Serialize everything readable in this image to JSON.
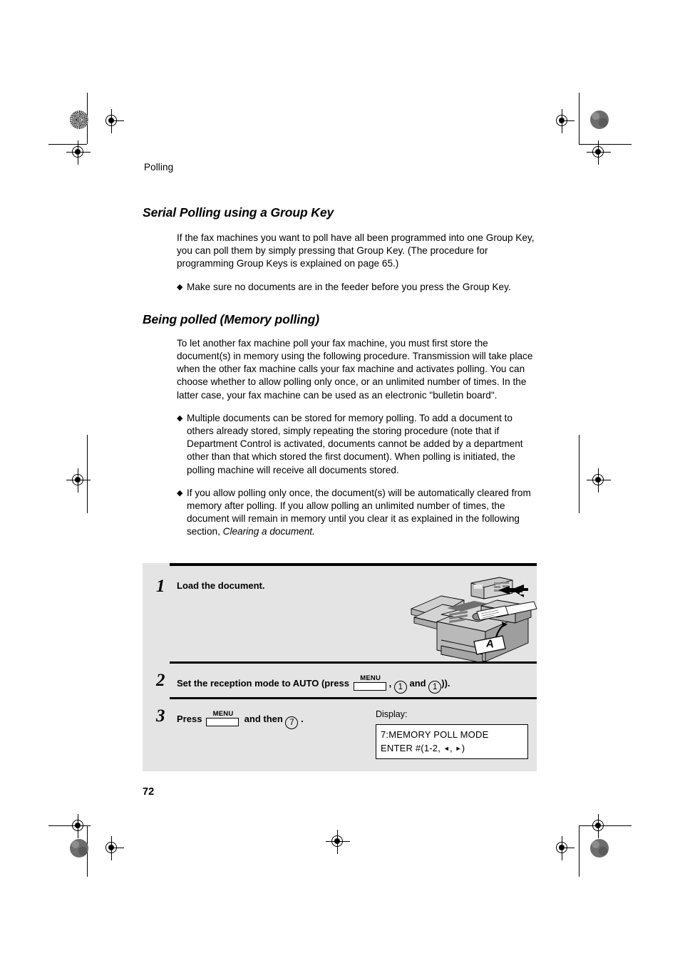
{
  "page": {
    "running_head": "Polling",
    "page_number": "72"
  },
  "sections": [
    {
      "heading": "Serial Polling using a Group Key",
      "paragraphs": [
        "If the fax machines you want to poll have all been programmed into one Group Key, you can poll them by simply pressing that Group Key. (The procedure for programming Group Keys is explained on page 65.)"
      ],
      "bullets": [
        "Make sure no documents are in the feeder before you press the Group Key."
      ]
    },
    {
      "heading": "Being polled (Memory polling)",
      "paragraphs": [
        "To let another fax machine poll your fax machine, you must first store the document(s) in memory using the following procedure. Transmission will take place when the other fax machine calls your fax machine and activates polling. You can choose whether to allow polling only once, or an unlimited number of times. In the latter case, your fax machine can be used as an electronic \"bulletin board\"."
      ],
      "bullets": [
        "Multiple documents can be stored for memory polling. To add a document to others already stored, simply repeating the storing procedure (note that if Department Control is activated, documents cannot be added by a department other than that which stored the first document). When polling is initiated, the polling machine will receive all documents stored.",
        "If you allow polling only once, the document(s) will be automatically cleared from memory after polling. If you allow polling an unlimited number of times, the document will remain in memory until you clear it as explained in the following section, "
      ],
      "bullet_italic_tail": "Clearing a document."
    }
  ],
  "steps": {
    "step1": {
      "number": "1",
      "text": "Load the document."
    },
    "step2": {
      "number": "2",
      "text_before": "Set the reception mode to AUTO (press",
      "menu_label": "MENU",
      "comma": ",",
      "key1": "1",
      "and": "and",
      "key2": "1",
      "text_after": "))."
    },
    "step3": {
      "number": "3",
      "text_before": "Press",
      "menu_label": "MENU",
      "text_mid": "and then",
      "key": "7",
      "text_after": "."
    }
  },
  "display": {
    "label": "Display:",
    "line1": "7:MEMORY POLL MODE",
    "line2_prefix": "ENTER #(1-2, ",
    "line2_left_arrow": "◄",
    "line2_sep": ", ",
    "line2_right_arrow": "►",
    "line2_suffix": ")"
  },
  "illustration": {
    "name": "fax-machine-load-document",
    "document_letter": "A"
  },
  "colors": {
    "panel_background": "#e4e4e4",
    "rule": "#000000",
    "page_background": "#ffffff"
  }
}
